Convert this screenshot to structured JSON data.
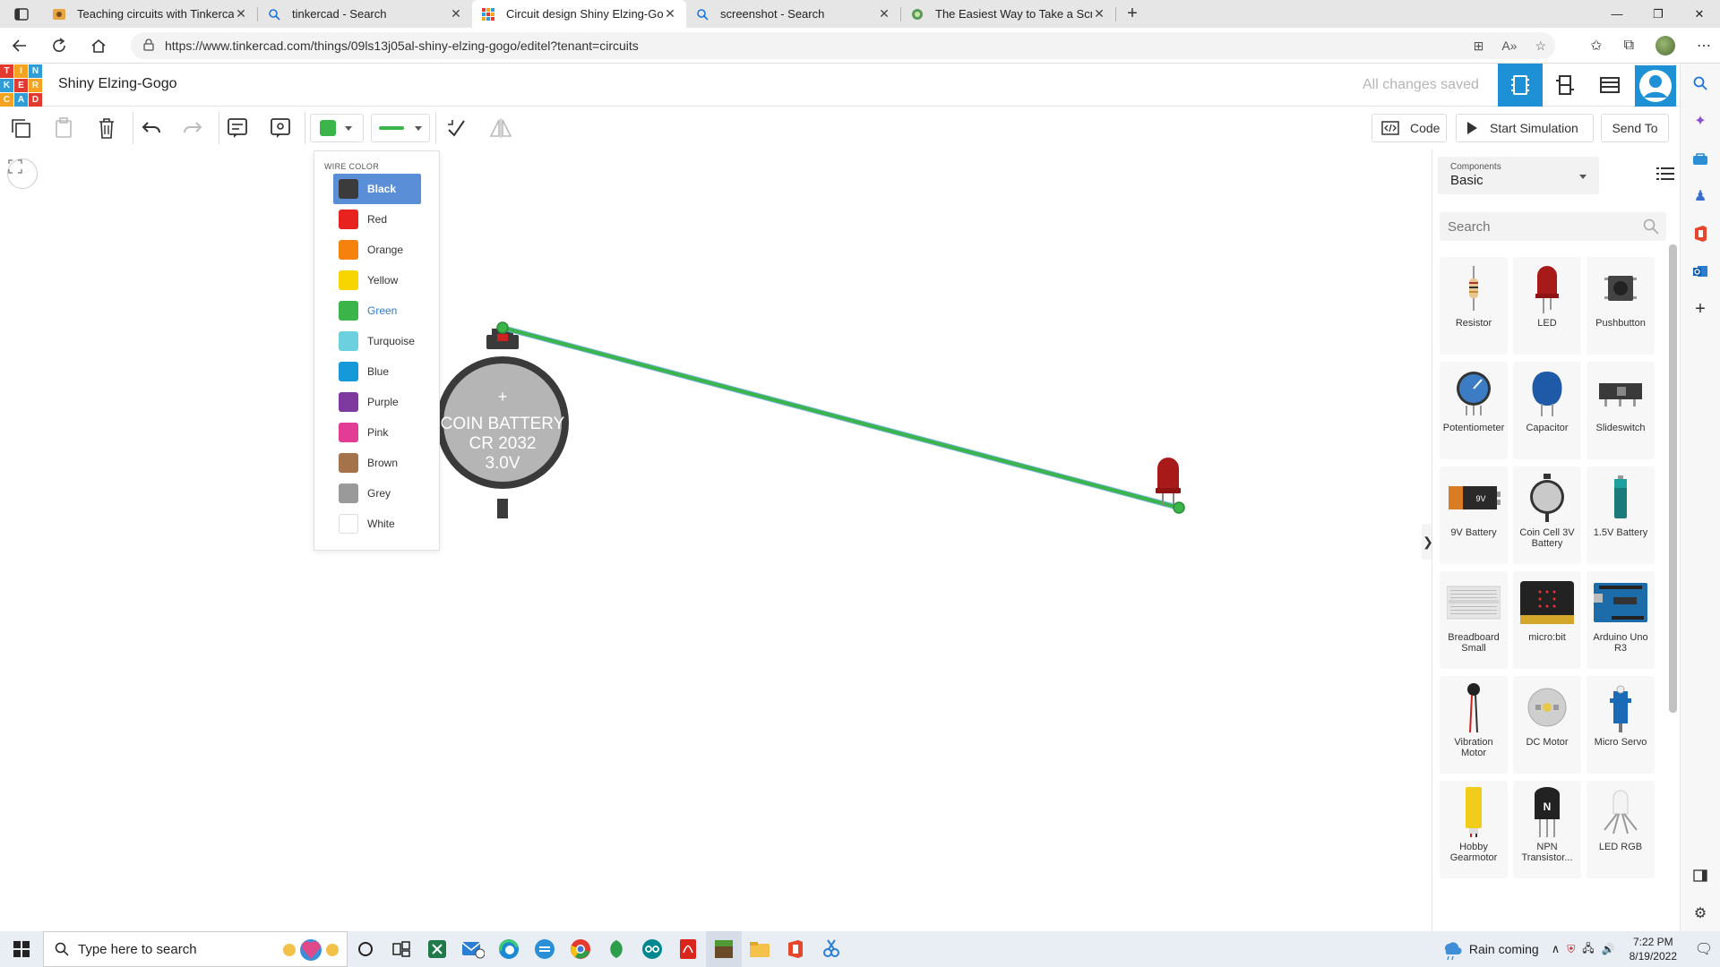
{
  "browser": {
    "tabs": [
      {
        "title": "Teaching circuits with Tinkercad",
        "icon": "tinkercad-favicon"
      },
      {
        "title": "tinkercad - Search",
        "icon": "search-icon"
      },
      {
        "title": "Circuit design Shiny Elzing-Gogo",
        "icon": "tinkercad-grid-favicon",
        "active": true
      },
      {
        "title": "screenshot - Search",
        "icon": "search-icon"
      },
      {
        "title": "The Easiest Way to Take a Screen",
        "icon": "site-favicon"
      }
    ],
    "url": "https://www.tinkercad.com/things/09ls13j05al-shiny-elzing-gogo/editel?tenant=circuits"
  },
  "app": {
    "logo_letters": [
      "T",
      "I",
      "N",
      "K",
      "E",
      "R",
      "C",
      "A",
      "D"
    ],
    "logo_colors": [
      "#e33a2f",
      "#f4a21f",
      "#2f9ed8",
      "#2f9ed8",
      "#e33a2f",
      "#f4a21f",
      "#f4a21f",
      "#2f9ed8",
      "#e33a2f"
    ],
    "project_title": "Shiny Elzing-Gogo",
    "save_status": "All changes saved",
    "accent": "#1e90d6"
  },
  "toolbar": {
    "code_label": "Code",
    "sim_label": "Start Simulation",
    "send_label": "Send To",
    "current_wire_color": "#3bb54a"
  },
  "wire_menu": {
    "title": "WIRE COLOR",
    "items": [
      {
        "label": "Black",
        "color": "#3b3b3b",
        "state": "selected"
      },
      {
        "label": "Red",
        "color": "#e8231f"
      },
      {
        "label": "Orange",
        "color": "#f5820d"
      },
      {
        "label": "Yellow",
        "color": "#f6d500"
      },
      {
        "label": "Green",
        "color": "#3bb54a",
        "state": "current"
      },
      {
        "label": "Turquoise",
        "color": "#6dd0de"
      },
      {
        "label": "Blue",
        "color": "#1599d9"
      },
      {
        "label": "Purple",
        "color": "#7f3aa0"
      },
      {
        "label": "Pink",
        "color": "#e23c95"
      },
      {
        "label": "Brown",
        "color": "#a4734a"
      },
      {
        "label": "Grey",
        "color": "#9a9a9a"
      },
      {
        "label": "White",
        "color": "#ffffff"
      }
    ]
  },
  "canvas": {
    "battery_lines": [
      "COIN BATTERY",
      "CR 2032",
      "3.0V"
    ],
    "battery_plus": "+"
  },
  "components": {
    "select_label": "Components",
    "select_value": "Basic",
    "search_placeholder": "Search",
    "items": [
      {
        "name": "Resistor",
        "icon": "resistor-icon"
      },
      {
        "name": "LED",
        "icon": "led-icon"
      },
      {
        "name": "Pushbutton",
        "icon": "pushbutton-icon"
      },
      {
        "name": "Potentiometer",
        "icon": "potentiometer-icon"
      },
      {
        "name": "Capacitor",
        "icon": "capacitor-icon"
      },
      {
        "name": "Slideswitch",
        "icon": "slideswitch-icon"
      },
      {
        "name": "9V Battery",
        "icon": "battery-9v-icon"
      },
      {
        "name": "Coin Cell 3V Battery",
        "icon": "coin-cell-icon"
      },
      {
        "name": "1.5V Battery",
        "icon": "battery-aa-icon"
      },
      {
        "name": "Breadboard Small",
        "icon": "breadboard-icon"
      },
      {
        "name": "micro:bit",
        "icon": "microbit-icon"
      },
      {
        "name": "Arduino Uno R3",
        "icon": "arduino-icon"
      },
      {
        "name": "Vibration Motor",
        "icon": "vibration-motor-icon"
      },
      {
        "name": "DC Motor",
        "icon": "dc-motor-icon"
      },
      {
        "name": "Micro Servo",
        "icon": "servo-icon"
      },
      {
        "name": "Hobby Gearmotor",
        "icon": "gearmotor-icon"
      },
      {
        "name": "NPN Transistor...",
        "icon": "transistor-icon"
      },
      {
        "name": "LED RGB",
        "icon": "rgb-led-icon"
      }
    ],
    "transistor_letter": "N",
    "battery_9v_text": "9V"
  },
  "taskbar": {
    "search_placeholder": "Type here to search",
    "weather": "Rain coming",
    "time": "7:22 PM",
    "date": "8/19/2022"
  }
}
